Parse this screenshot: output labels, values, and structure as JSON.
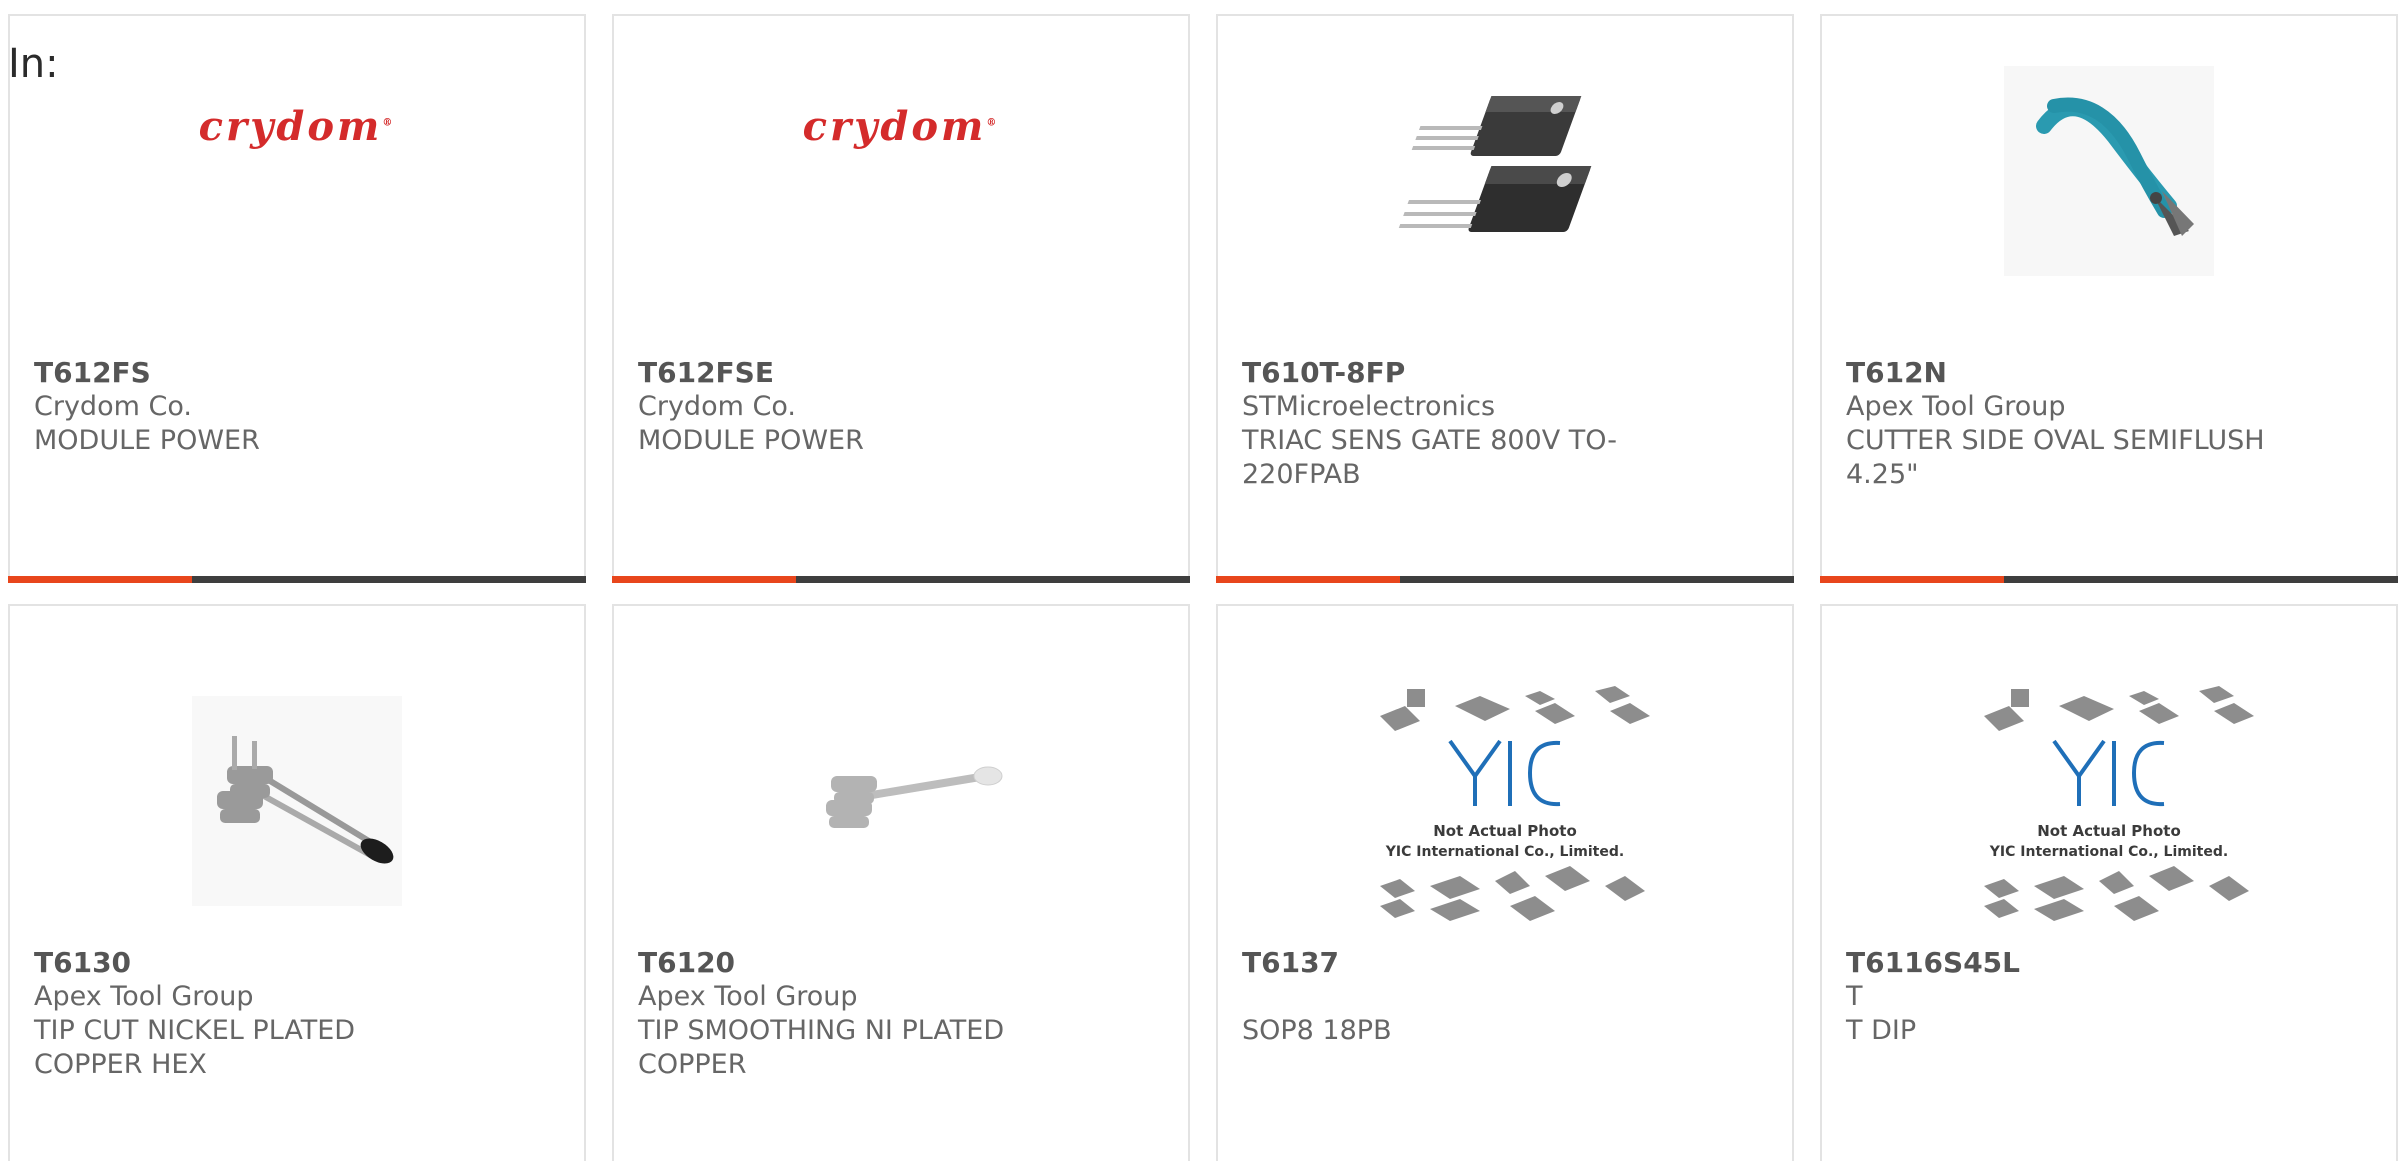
{
  "filter_label": "In:",
  "colors": {
    "accent": "#e8461c",
    "bar": "#3e3e3e",
    "brand_red": "#d42b2b",
    "yic_blue": "#1f6fb8"
  },
  "products": [
    {
      "part": "T612FS",
      "manufacturer": "Crydom Co.",
      "description": "MODULE POWER",
      "image": "crydom-logo"
    },
    {
      "part": "T612FSE",
      "manufacturer": "Crydom Co.",
      "description": "MODULE POWER",
      "image": "crydom-logo"
    },
    {
      "part": "T610T-8FP",
      "manufacturer": "STMicroelectronics",
      "description": "TRIAC SENS GATE 800V TO-220FPAB",
      "image": "to220-transistor-photo"
    },
    {
      "part": "T612N",
      "manufacturer": "Apex Tool Group",
      "description": "CUTTER SIDE OVAL SEMIFLUSH 4.25\"",
      "image": "side-cutter-pliers-photo"
    },
    {
      "part": "T6130",
      "manufacturer": "Apex Tool Group",
      "description": "TIP CUT NICKEL PLATED COPPER HEX",
      "image": "soldering-tip-photo"
    },
    {
      "part": "T6120",
      "manufacturer": "Apex Tool Group",
      "description": "TIP SMOOTHING NI PLATED COPPER",
      "image": "soldering-tip-photo"
    },
    {
      "part": "T6137",
      "manufacturer": "",
      "description": "SOP8 18PB",
      "image": "yic-placeholder"
    },
    {
      "part": "T6116S45L",
      "manufacturer": "T",
      "description": "T DIP",
      "image": "yic-placeholder"
    }
  ],
  "logo": {
    "brand": "crydom",
    "trademark": "®"
  },
  "placeholder": {
    "line1": "Not Actual Photo",
    "line2": "YIC International Co., Limited.",
    "mark": "YIC"
  }
}
